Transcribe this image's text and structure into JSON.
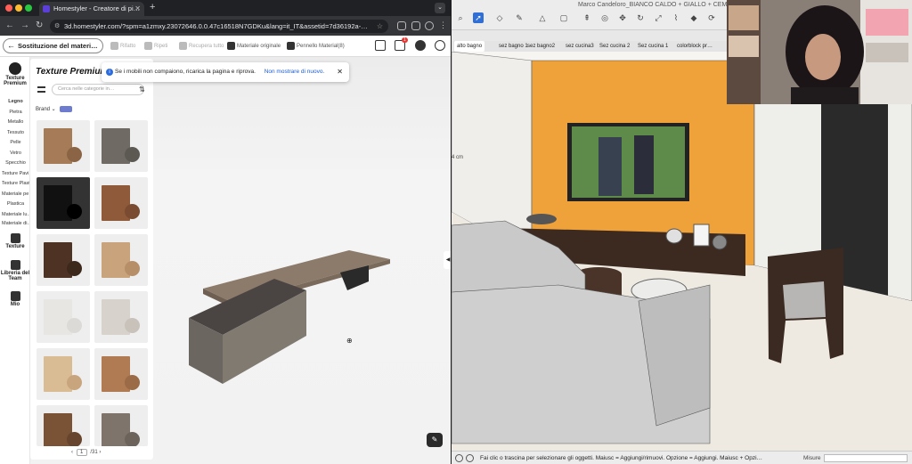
{
  "browser": {
    "tab_title": "Homestyler - Creatore di pi…",
    "url": "3d.homestyler.com/?spm=a1zmxy.23072646.0.0.47c16518N7GDKu&lang=it_IT&assetid=7d36192a-…"
  },
  "toolbar": {
    "back_label": "Sostituzione del materi…",
    "undo": "Rifatto",
    "redo": "Ripeti",
    "restore_all": "Recupera tutto",
    "original_material": "Materiale originale",
    "brush": "Pennello Material(8)",
    "notification_count": "1"
  },
  "sidebar": {
    "groups": [
      {
        "label": "Texture Premium"
      },
      {
        "label": "Texture"
      },
      {
        "label": "Libreria del Team"
      },
      {
        "label": "Mio"
      }
    ],
    "items": [
      "Legno",
      "Pietra",
      "Metallo",
      "Tessuto",
      "Pelle",
      "Vetro",
      "Specchio",
      "Texture Pavi…",
      "Texture Plast…",
      "Materiale pe…",
      "Plastica",
      "Materiale lu…",
      "Materiale di…"
    ]
  },
  "panel": {
    "title": "Texture Premium",
    "search_placeholder": "Cerca nelle categorie in…",
    "brand_label": "Brand",
    "page_current": "1",
    "page_total": "/31"
  },
  "toast": {
    "message": "Se i mobili non compaiono, ricarica la pagina e riprova.",
    "link": "Non mostrare di nuovo."
  },
  "sketchup": {
    "title": "Marco Candeloro_BIANCO CALDO + GIALLO + CEMENTO…",
    "scenes": [
      "alto bagno",
      "sez bagno 1",
      "sez bagno2",
      "sez cucina3",
      "Sez cucina 2",
      "Sez cucina 1",
      "colorblock pr…"
    ],
    "dimension": "4 cm",
    "status_message": "Fai clic o trascina per selezionare gli oggetti. Maiusc = Aggiungi/rimuovi. Opzione = Aggiungi. Maiusc + Opzi…",
    "measure_label": "Misure"
  },
  "colors": {
    "orange_wall": "#f0a23a",
    "sofa_gray": "#cfcfcf",
    "floor": "#eeeae2"
  }
}
